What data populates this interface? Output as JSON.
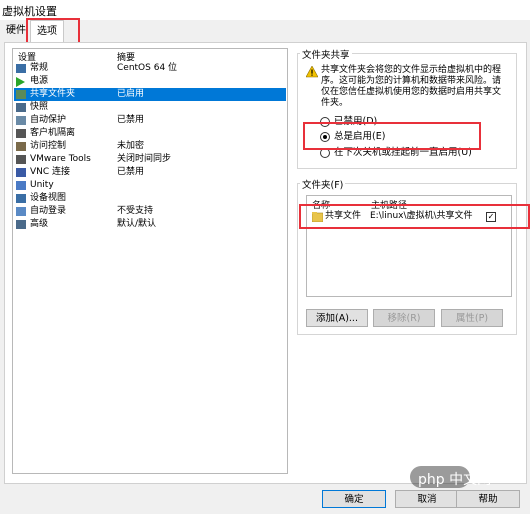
{
  "window": {
    "title": "虚拟机设置"
  },
  "tabs": [
    {
      "label": "硬件"
    },
    {
      "label": "选项"
    }
  ],
  "list": {
    "header": {
      "col1": "设置",
      "col2": "摘要"
    },
    "items": [
      {
        "label": "常规",
        "summary": "CentOS 64 位",
        "icon": "general-icon",
        "color": "#3a6ea5"
      },
      {
        "label": "电源",
        "summary": "",
        "icon": "power-play-icon",
        "color": "#2aa52a"
      },
      {
        "label": "共享文件夹",
        "summary": "已启用",
        "icon": "shared-folder-icon",
        "color": "#5a8a5a"
      },
      {
        "label": "快照",
        "summary": "",
        "icon": "snapshot-icon",
        "color": "#4a6a8a"
      },
      {
        "label": "自动保护",
        "summary": "已禁用",
        "icon": "autoprotect-icon",
        "color": "#6a8aa6"
      },
      {
        "label": "客户机隔离",
        "summary": "",
        "icon": "isolation-icon",
        "color": "#555555"
      },
      {
        "label": "访问控制",
        "summary": "未加密",
        "icon": "access-control-icon",
        "color": "#7a6a4a"
      },
      {
        "label": "VMware Tools",
        "summary": "关闭时间同步",
        "icon": "vmware-tools-icon",
        "color": "#555555"
      },
      {
        "label": "VNC 连接",
        "summary": "已禁用",
        "icon": "vnc-icon",
        "color": "#3a5aa5"
      },
      {
        "label": "Unity",
        "summary": "",
        "icon": "unity-icon",
        "color": "#4a7ac5"
      },
      {
        "label": "设备视图",
        "summary": "",
        "icon": "device-view-icon",
        "color": "#3a6ea5"
      },
      {
        "label": "自动登录",
        "summary": "不受支持",
        "icon": "autologin-icon",
        "color": "#5a8ac5"
      },
      {
        "label": "高级",
        "summary": "默认/默认",
        "icon": "advanced-icon",
        "color": "#4a6a8a"
      }
    ],
    "selected_index": 2
  },
  "shared_folders": {
    "legend": "文件夹共享",
    "warning": "共享文件夹会将您的文件显示给虚拟机中的程序。这可能为您的计算机和数据带来风险。请仅在您信任虚拟机使用您的数据时启用共享文件夹。",
    "options": [
      {
        "label": "已禁用(D)",
        "checked": false
      },
      {
        "label": "总是启用(E)",
        "checked": true
      },
      {
        "label": "在下次关机或挂起前一直启用(U)",
        "checked": false
      }
    ]
  },
  "folders": {
    "legend": "文件夹(F)",
    "columns": {
      "name": "名称",
      "host_path": "主机路径"
    },
    "rows": [
      {
        "name": "共享文件",
        "path": "E:\\linux\\虚拟机\\共享文件",
        "checked": true
      }
    ],
    "buttons": {
      "add": "添加(A)...",
      "remove": "移除(R)",
      "properties": "属性(P)"
    }
  },
  "footer": {
    "ok": "确定",
    "cancel": "取消",
    "help": "帮助"
  },
  "watermark": "php 中文网",
  "colors": {
    "selection": "#0078d7",
    "highlight": "#e8303a"
  }
}
